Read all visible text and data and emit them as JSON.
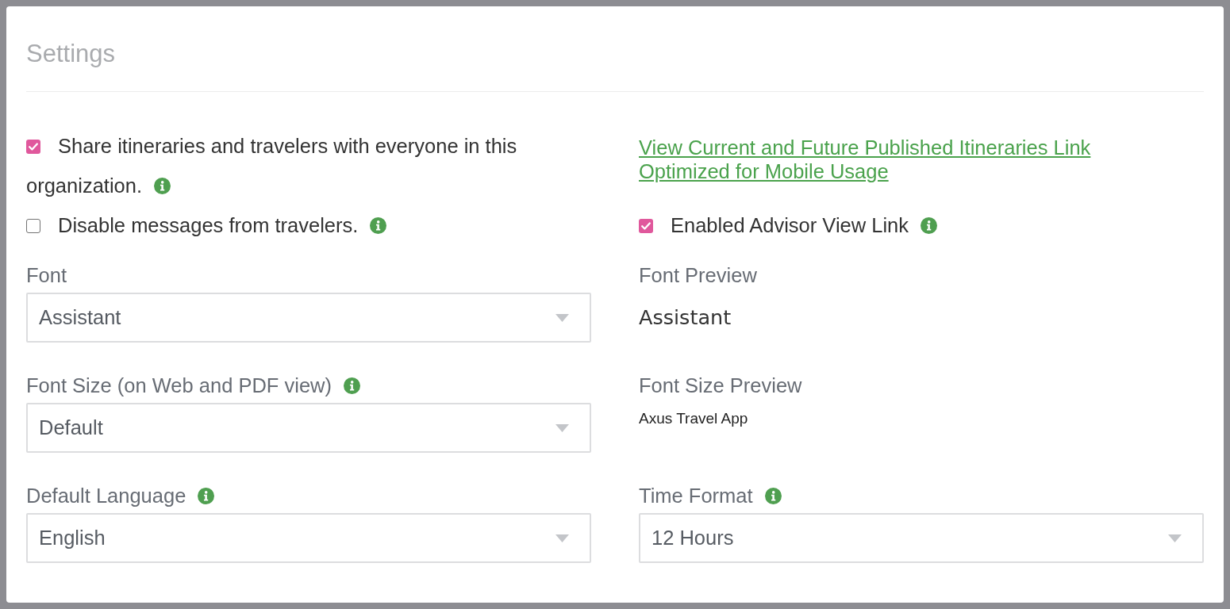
{
  "window": {
    "title": "Settings"
  },
  "rows": [
    {
      "cells": [
        {
          "kind": "checkbox",
          "label": "Share itineraries and travelers with everyone in this organization.",
          "checked": true,
          "info": true
        },
        {
          "kind": "link",
          "text": "View Current and Future Published Itineraries Link Optimized for Mobile Usage"
        }
      ]
    },
    {
      "cells": [
        {
          "kind": "checkbox",
          "label": "Disable messages from travelers.",
          "checked": false,
          "info": true
        },
        {
          "kind": "checkbox",
          "label": "Enabled Advisor View Link",
          "checked": true,
          "info": true
        }
      ]
    },
    {
      "cells": [
        {
          "kind": "select",
          "label": "Font",
          "info": false,
          "value": "Assistant"
        },
        {
          "kind": "font_preview",
          "label": "Font Preview",
          "sample": "Assistant"
        }
      ]
    },
    {
      "cells": [
        {
          "kind": "select",
          "label": "Font Size (on Web and PDF view)",
          "info": true,
          "value": "Default"
        },
        {
          "kind": "size_preview",
          "label": "Font Size Preview",
          "sample": "Axus Travel App"
        }
      ]
    },
    {
      "cells": [
        {
          "kind": "select",
          "label": "Default Language",
          "info": true,
          "value": "English"
        },
        {
          "kind": "select",
          "label": "Time Format",
          "info": true,
          "value": "12 Hours"
        }
      ]
    }
  ]
}
